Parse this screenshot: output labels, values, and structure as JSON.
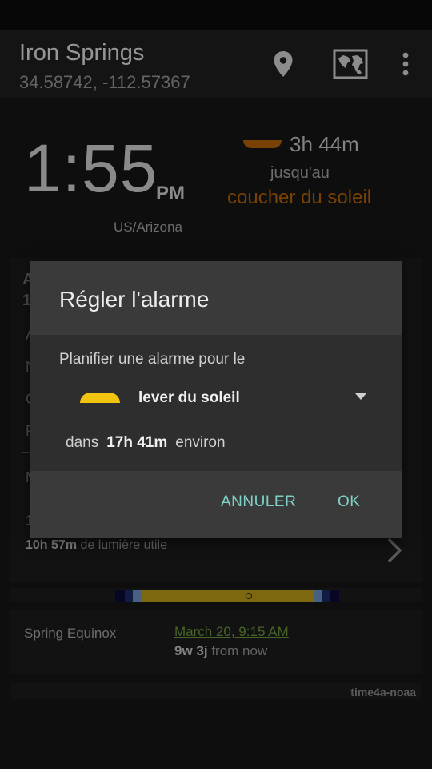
{
  "appbar": {
    "title": "Iron Springs",
    "coordinates": "34.58742, -112.57367",
    "icons": [
      "location-pin-icon",
      "world-map-icon",
      "overflow-menu-icon"
    ]
  },
  "clock": {
    "time": "1:55",
    "ampm": "PM",
    "timezone": "US/Arizona"
  },
  "next_event": {
    "countdown": "3h 44m",
    "until": "jusqu'au",
    "name": "coucher du soleil"
  },
  "daylight": {
    "duration": "10h 57m",
    "label": "de lumière utile"
  },
  "equinox": {
    "label": "Spring Equinox",
    "date": "March 20, 9:15 AM",
    "relative_value": "9w 3j",
    "relative_suffix": "from now"
  },
  "footer": {
    "source": "time4a-noaa"
  },
  "background_card_fragments": {
    "line1": "A",
    "line2": "1",
    "line3": "A",
    "line4": "N",
    "line5": "C",
    "line6": "F",
    "line7": "M",
    "line8": "1"
  },
  "dialog": {
    "title": "Régler l'alarme",
    "prompt": "Planifier une alarme pour le",
    "selected_event": "lever du soleil",
    "in_prefix": "dans",
    "in_value": "17h 41m",
    "in_suffix": "environ",
    "cancel_label": "ANNULER",
    "ok_label": "OK"
  },
  "colors": {
    "sunset": "#b8650a",
    "sunrise": "#f1c40f",
    "accent_button": "#7fd1c8",
    "link_green": "#6e9a3e"
  }
}
